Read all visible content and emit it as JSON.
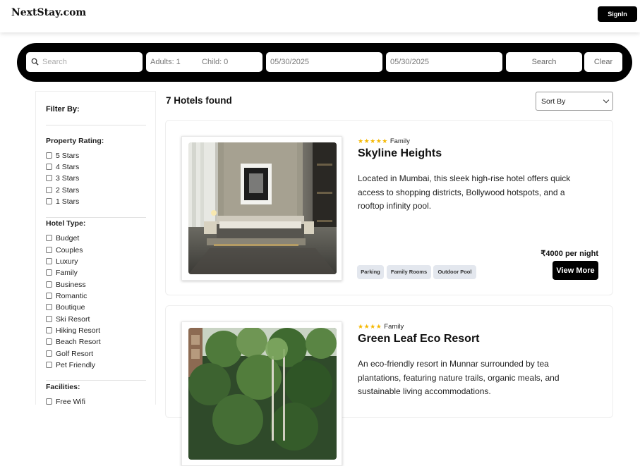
{
  "header": {
    "logo": "NextStay.com",
    "signin_label": "SignIn"
  },
  "searchbar": {
    "search_placeholder": "Search",
    "adults": "Adults: 1",
    "child": "Child: 0",
    "checkin": "05/30/2025",
    "checkout": "05/30/2025",
    "search_label": "Search",
    "clear_label": "Clear"
  },
  "sidebar": {
    "title": "Filter By:",
    "rating_title": "Property Rating:",
    "ratings": [
      "5 Stars",
      "4 Stars",
      "3 Stars",
      "2 Stars",
      "1 Stars"
    ],
    "type_title": "Hotel Type:",
    "types": [
      "Budget",
      "Couples",
      "Luxury",
      "Family",
      "Business",
      "Romantic",
      "Boutique",
      "Ski Resort",
      "Hiking Resort",
      "Beach Resort",
      "Golf Resort",
      "Pet Friendly"
    ],
    "facilities_title": "Facilities:",
    "facilities": [
      "Free Wifi"
    ]
  },
  "results": {
    "found_text": "7 Hotels found",
    "sort_label": "Sort By"
  },
  "hotels": [
    {
      "stars": "★★★★★",
      "rating_count": 5,
      "type": "Family",
      "name": "Skyline Heights",
      "description": "Located in Mumbai, this sleek high-rise hotel offers quick access to shopping districts, Bollywood hotspots, and a rooftop infinity pool.",
      "price": "₹4000 per night",
      "amenities": [
        "Parking",
        "Family Rooms",
        "Outdoor Pool"
      ],
      "view_more": "View More"
    },
    {
      "stars": "★★★★",
      "rating_count": 4,
      "type": "Family",
      "name": "Green Leaf Eco Resort",
      "description": "An eco-friendly resort in Munnar surrounded by tea plantations, featuring nature trails, organic meals, and sustainable living accommodations."
    }
  ]
}
